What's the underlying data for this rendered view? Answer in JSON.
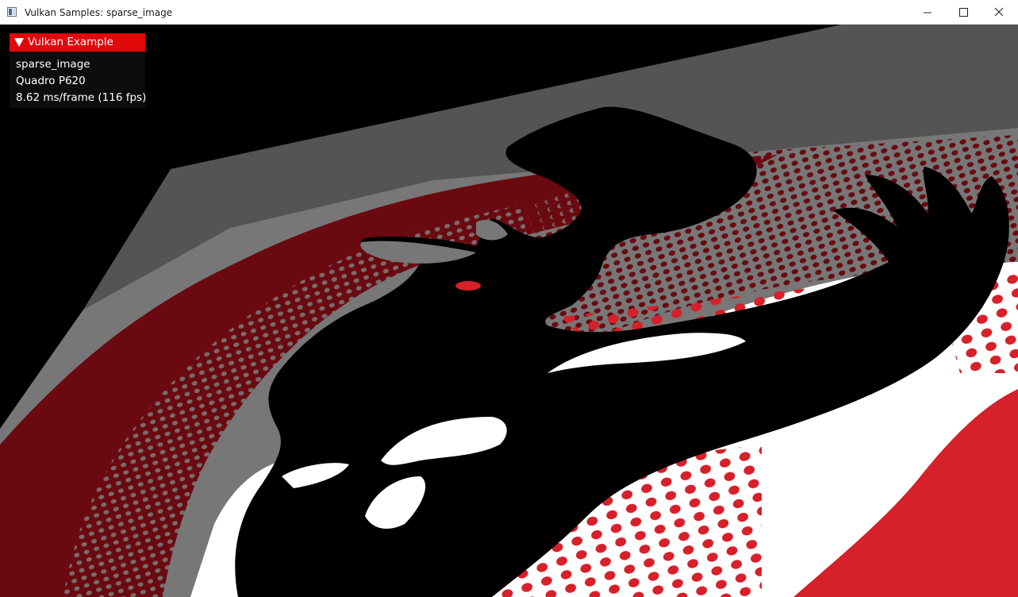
{
  "window": {
    "title": "Vulkan Samples: sparse_image",
    "controls": [
      "minimize-icon",
      "maximize-icon",
      "close-icon"
    ]
  },
  "overlay": {
    "header": "Vulkan Example",
    "sample_name": "sparse_image",
    "gpu": "Quadro P620",
    "frame_time": "8.62 ms/frame (116 fps)",
    "header_color": "#e00808",
    "expander_icon": "triangle-down-icon"
  },
  "scene": {
    "colors": {
      "background": "#000000",
      "plane_dark": "#545454",
      "plane_mid": "#777777",
      "dark_red": "#6a0a10",
      "red": "#d6202a",
      "white": "#ffffff",
      "silhouette": "#000000"
    }
  }
}
